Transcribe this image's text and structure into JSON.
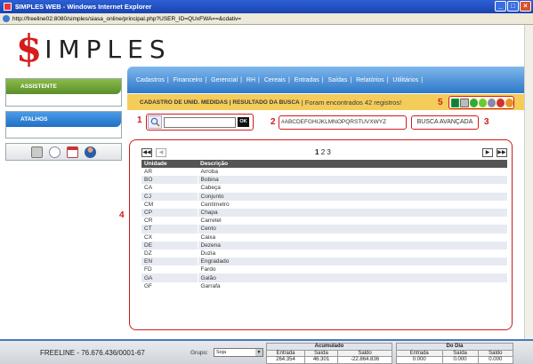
{
  "window": {
    "title": "$IMPLES WEB - Windows Internet Explorer",
    "url": "http://freeline02:8080/simples/siasa_online/principal.php?USER_ID=QUxFWA==&cdativ="
  },
  "logo": {
    "dollar": "$",
    "rest": "IMPLES"
  },
  "sidebar": {
    "assistente": "ASSISTENTE",
    "atalhos": "ATALHOS"
  },
  "menu": {
    "items": [
      "Cadastros",
      "Financeiro",
      "Gerencial",
      "RH",
      "Cereais",
      "Entradas",
      "Saídas",
      "Relatórios",
      "Utilitários"
    ]
  },
  "status": {
    "title": "CADASTRO DE UNID. MEDIDAS | RESULTADO DA BUSCA",
    "found": "| Foram encontrados 42 registros!"
  },
  "markers": [
    "1",
    "2",
    "3",
    "4",
    "5"
  ],
  "search": {
    "value": "",
    "ok_label": "OK"
  },
  "alphabet": "#ABCDEFGHIJKLMNOPQRSTUVXWYZ",
  "advanced_search": "BUSCA AVANÇADA",
  "pagination": {
    "current": "1",
    "others": "2 3"
  },
  "table": {
    "headers": [
      "Unidade",
      "Descrição"
    ],
    "rows": [
      [
        "AR",
        "Arroba"
      ],
      [
        "BO",
        "Bobina"
      ],
      [
        "CA",
        "Cabeça"
      ],
      [
        "CJ",
        "Conjunto"
      ],
      [
        "CM",
        "Centímetro"
      ],
      [
        "CP",
        "Chapa"
      ],
      [
        "CR",
        "Carretel"
      ],
      [
        "CT",
        "Cento"
      ],
      [
        "CX",
        "Caixa"
      ],
      [
        "DE",
        "Dezena"
      ],
      [
        "DZ",
        "Duzia"
      ],
      [
        "EN",
        "Engradado"
      ],
      [
        "FD",
        "Fardo"
      ],
      [
        "GA",
        "Galão"
      ],
      [
        "GF",
        "Garrafa"
      ]
    ]
  },
  "footer": {
    "company": "FREELINE - 76.676.436/0001-67",
    "grupo_label": "Grupo:",
    "grupo_value": "Soja",
    "acumulado": {
      "title": "Acumulado",
      "entrada": "264.354",
      "saida": "46.301",
      "saldo": "-22.864.836"
    },
    "dodia": {
      "title": "Do Dia",
      "entrada": "0.000",
      "saida": "0.000",
      "saldo": "0.000"
    },
    "col_entrada": "Entrada",
    "col_saida": "Saída",
    "col_saldo": "Saldo"
  }
}
